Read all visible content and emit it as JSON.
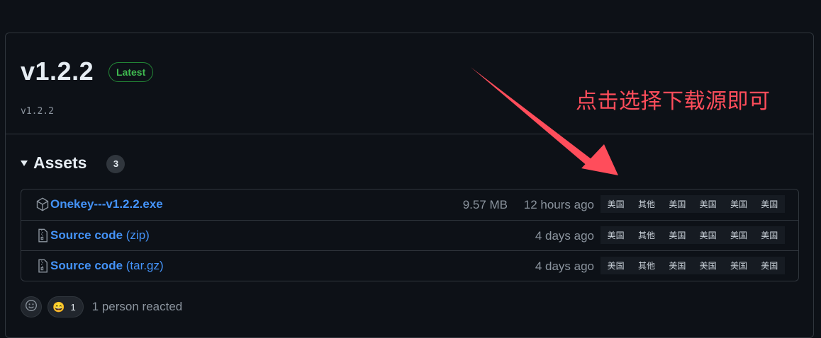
{
  "release": {
    "title": "v1.2.2",
    "latest_badge": "Latest",
    "tag": "v1.2.2"
  },
  "assets": {
    "label": "Assets",
    "count": "3",
    "rows": [
      {
        "name": "Onekey---v1.2.2.exe",
        "ext": "",
        "size": "9.57 MB",
        "date": "12 hours ago",
        "icon": "package-icon"
      },
      {
        "name": "Source code",
        "ext": " (zip)",
        "size": "",
        "date": "4 days ago",
        "icon": "file-zip-icon"
      },
      {
        "name": "Source code",
        "ext": " (tar.gz)",
        "size": "",
        "date": "4 days ago",
        "icon": "file-zip-icon"
      }
    ],
    "mirrors": [
      "美国",
      "其他",
      "美国",
      "美国",
      "美国",
      "美国"
    ]
  },
  "reactions": {
    "emoji": "😄",
    "count": "1",
    "summary": "1 person reacted"
  },
  "annotation": {
    "text": "点击选择下载源即可",
    "color": "#ff4d5b"
  },
  "colors": {
    "background": "#0d1117",
    "border": "#30363d",
    "link": "#4493f8",
    "latest_green": "#3fb950",
    "muted": "#8b949e"
  }
}
